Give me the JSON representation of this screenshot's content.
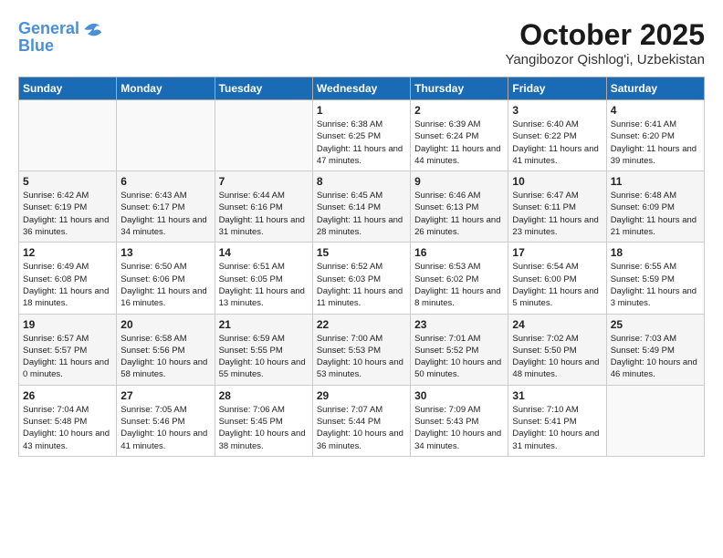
{
  "header": {
    "logo_line1": "General",
    "logo_line2": "Blue",
    "title": "October 2025",
    "subtitle": "Yangibozor Qishlog'i, Uzbekistan"
  },
  "days_of_week": [
    "Sunday",
    "Monday",
    "Tuesday",
    "Wednesday",
    "Thursday",
    "Friday",
    "Saturday"
  ],
  "weeks": [
    [
      {
        "day": "",
        "info": ""
      },
      {
        "day": "",
        "info": ""
      },
      {
        "day": "",
        "info": ""
      },
      {
        "day": "1",
        "info": "Sunrise: 6:38 AM\nSunset: 6:25 PM\nDaylight: 11 hours and 47 minutes."
      },
      {
        "day": "2",
        "info": "Sunrise: 6:39 AM\nSunset: 6:24 PM\nDaylight: 11 hours and 44 minutes."
      },
      {
        "day": "3",
        "info": "Sunrise: 6:40 AM\nSunset: 6:22 PM\nDaylight: 11 hours and 41 minutes."
      },
      {
        "day": "4",
        "info": "Sunrise: 6:41 AM\nSunset: 6:20 PM\nDaylight: 11 hours and 39 minutes."
      }
    ],
    [
      {
        "day": "5",
        "info": "Sunrise: 6:42 AM\nSunset: 6:19 PM\nDaylight: 11 hours and 36 minutes."
      },
      {
        "day": "6",
        "info": "Sunrise: 6:43 AM\nSunset: 6:17 PM\nDaylight: 11 hours and 34 minutes."
      },
      {
        "day": "7",
        "info": "Sunrise: 6:44 AM\nSunset: 6:16 PM\nDaylight: 11 hours and 31 minutes."
      },
      {
        "day": "8",
        "info": "Sunrise: 6:45 AM\nSunset: 6:14 PM\nDaylight: 11 hours and 28 minutes."
      },
      {
        "day": "9",
        "info": "Sunrise: 6:46 AM\nSunset: 6:13 PM\nDaylight: 11 hours and 26 minutes."
      },
      {
        "day": "10",
        "info": "Sunrise: 6:47 AM\nSunset: 6:11 PM\nDaylight: 11 hours and 23 minutes."
      },
      {
        "day": "11",
        "info": "Sunrise: 6:48 AM\nSunset: 6:09 PM\nDaylight: 11 hours and 21 minutes."
      }
    ],
    [
      {
        "day": "12",
        "info": "Sunrise: 6:49 AM\nSunset: 6:08 PM\nDaylight: 11 hours and 18 minutes."
      },
      {
        "day": "13",
        "info": "Sunrise: 6:50 AM\nSunset: 6:06 PM\nDaylight: 11 hours and 16 minutes."
      },
      {
        "day": "14",
        "info": "Sunrise: 6:51 AM\nSunset: 6:05 PM\nDaylight: 11 hours and 13 minutes."
      },
      {
        "day": "15",
        "info": "Sunrise: 6:52 AM\nSunset: 6:03 PM\nDaylight: 11 hours and 11 minutes."
      },
      {
        "day": "16",
        "info": "Sunrise: 6:53 AM\nSunset: 6:02 PM\nDaylight: 11 hours and 8 minutes."
      },
      {
        "day": "17",
        "info": "Sunrise: 6:54 AM\nSunset: 6:00 PM\nDaylight: 11 hours and 5 minutes."
      },
      {
        "day": "18",
        "info": "Sunrise: 6:55 AM\nSunset: 5:59 PM\nDaylight: 11 hours and 3 minutes."
      }
    ],
    [
      {
        "day": "19",
        "info": "Sunrise: 6:57 AM\nSunset: 5:57 PM\nDaylight: 11 hours and 0 minutes."
      },
      {
        "day": "20",
        "info": "Sunrise: 6:58 AM\nSunset: 5:56 PM\nDaylight: 10 hours and 58 minutes."
      },
      {
        "day": "21",
        "info": "Sunrise: 6:59 AM\nSunset: 5:55 PM\nDaylight: 10 hours and 55 minutes."
      },
      {
        "day": "22",
        "info": "Sunrise: 7:00 AM\nSunset: 5:53 PM\nDaylight: 10 hours and 53 minutes."
      },
      {
        "day": "23",
        "info": "Sunrise: 7:01 AM\nSunset: 5:52 PM\nDaylight: 10 hours and 50 minutes."
      },
      {
        "day": "24",
        "info": "Sunrise: 7:02 AM\nSunset: 5:50 PM\nDaylight: 10 hours and 48 minutes."
      },
      {
        "day": "25",
        "info": "Sunrise: 7:03 AM\nSunset: 5:49 PM\nDaylight: 10 hours and 46 minutes."
      }
    ],
    [
      {
        "day": "26",
        "info": "Sunrise: 7:04 AM\nSunset: 5:48 PM\nDaylight: 10 hours and 43 minutes."
      },
      {
        "day": "27",
        "info": "Sunrise: 7:05 AM\nSunset: 5:46 PM\nDaylight: 10 hours and 41 minutes."
      },
      {
        "day": "28",
        "info": "Sunrise: 7:06 AM\nSunset: 5:45 PM\nDaylight: 10 hours and 38 minutes."
      },
      {
        "day": "29",
        "info": "Sunrise: 7:07 AM\nSunset: 5:44 PM\nDaylight: 10 hours and 36 minutes."
      },
      {
        "day": "30",
        "info": "Sunrise: 7:09 AM\nSunset: 5:43 PM\nDaylight: 10 hours and 34 minutes."
      },
      {
        "day": "31",
        "info": "Sunrise: 7:10 AM\nSunset: 5:41 PM\nDaylight: 10 hours and 31 minutes."
      },
      {
        "day": "",
        "info": ""
      }
    ]
  ]
}
